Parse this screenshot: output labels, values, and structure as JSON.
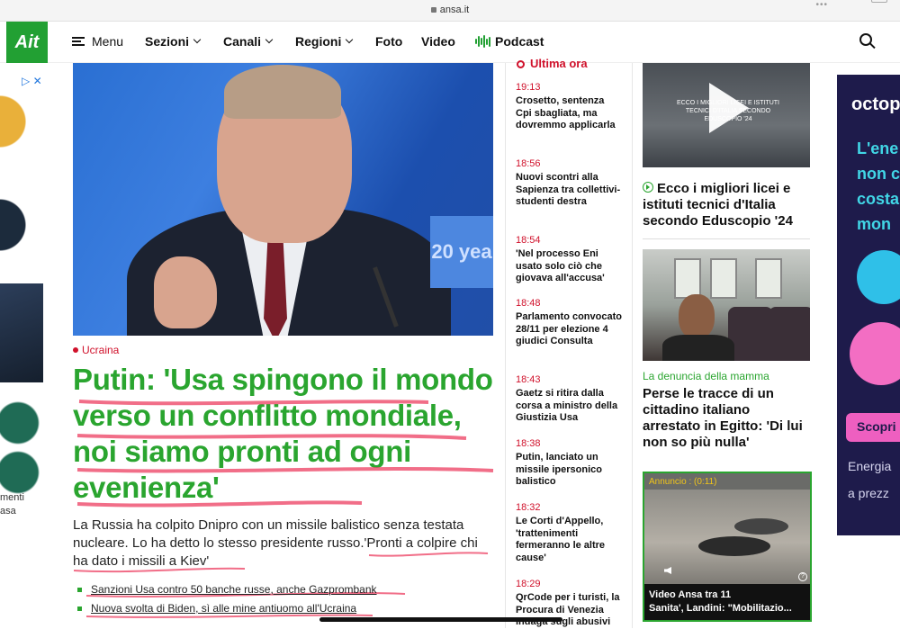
{
  "browser": {
    "url": "ansa.it"
  },
  "nav": {
    "logo": "Ait",
    "menu_label": "Menu",
    "items": [
      {
        "label": "Sezioni",
        "dropdown": true
      },
      {
        "label": "Canali",
        "dropdown": true
      },
      {
        "label": "Regioni",
        "dropdown": true
      },
      {
        "label": "Foto",
        "dropdown": false
      },
      {
        "label": "Video",
        "dropdown": false
      }
    ],
    "podcast_label": "Podcast"
  },
  "left_ad": {
    "text": "menti\nasa"
  },
  "main_story": {
    "kicker": "Ucraina",
    "headline": "Putin: 'Usa spingono il mondo verso un conflitto mondiale, noi siamo pronti ad ogni evenienza'",
    "summary": "La Russia ha colpito Dnipro con un missile balistico senza testata nucleare. Lo ha detto lo stesso presidente russo.'Pronti a colpire chi ha dato i missili a Kiev'",
    "related": [
      "Sanzioni Usa contro 50 banche russe, anche Gazprombank",
      "Nuova svolta di Biden, sì alle mine antiuomo all'Ucraina"
    ],
    "image_sign": "20 yea"
  },
  "latest": {
    "title": "Ultima ora",
    "items": [
      {
        "time": "19:13",
        "text": "Crosetto, sentenza Cpi sbagliata, ma dovremmo applicarla"
      },
      {
        "time": "18:56",
        "text": "Nuovi scontri alla Sapienza tra collettivi-studenti destra"
      },
      {
        "time": "18:54",
        "text": "'Nel processo Eni usato solo ciò che giovava all'accusa'"
      },
      {
        "time": "18:48",
        "text": "Parlamento convocato 28/11 per elezione 4 giudici Consulta"
      },
      {
        "time": "18:43",
        "text": "Gaetz si ritira dalla corsa a ministro della Giustizia Usa"
      },
      {
        "time": "18:38",
        "text": "Putin, lanciato un missile ipersonico balistico"
      },
      {
        "time": "18:32",
        "text": "Le Corti d'Appello, 'trattenimenti fermeranno le altre cause'"
      },
      {
        "time": "18:29",
        "text": "QrCode per i turisti, la Procura di Venezia indaga sugli abusivi"
      }
    ]
  },
  "right_col": {
    "video1_overlay": "ECCO I MIGLIORI LICEI E ISTITUTI TECNICI D'ITALIA SECONDO EDUSCOPIO '24",
    "video1_title": "Ecco i migliori licei e istituti tecnici d'Italia secondo Eduscopio '24",
    "story2_kicker": "La denuncia della mamma",
    "story2_title": "Perse le tracce di un cittadino italiano arrestato in Egitto: 'Di lui non so più nulla'",
    "video3_annuncio": "Annuncio : (0:11)",
    "video3_caption_1": "Video Ansa tra 11",
    "video3_caption_2": "Sanita', Landini: \"Mobilitazio..."
  },
  "right_ad": {
    "brand": "octop",
    "lines": [
      "L'ene",
      "non c",
      "costa",
      "mon"
    ],
    "button": "Scopri",
    "footer_1": "Energia",
    "footer_2": "a prezz"
  }
}
